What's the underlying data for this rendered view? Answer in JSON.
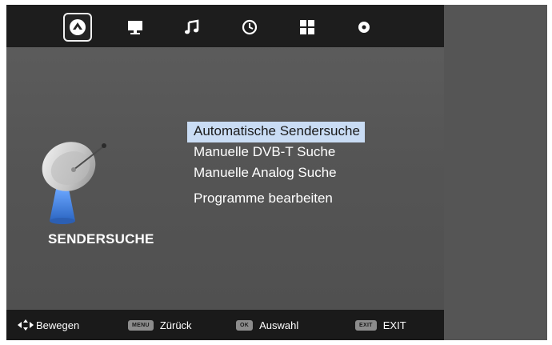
{
  "tabs": [
    {
      "icon": "satellite-dish-icon",
      "active": true
    },
    {
      "icon": "monitor-icon",
      "active": false
    },
    {
      "icon": "music-note-icon",
      "active": false
    },
    {
      "icon": "clock-icon",
      "active": false
    },
    {
      "icon": "grid-icon",
      "active": false
    },
    {
      "icon": "gear-icon",
      "active": false
    }
  ],
  "section": {
    "title": "SENDERSUCHE",
    "icon": "satellite-dish-icon"
  },
  "menu": {
    "items": [
      {
        "label": "Automatische Sendersuche",
        "selected": true
      },
      {
        "label": "Manuelle DVB-T Suche",
        "selected": false
      },
      {
        "label": "Manuelle Analog Suche",
        "selected": false
      },
      {
        "label": "Programme bearbeiten",
        "selected": false
      }
    ]
  },
  "footer": {
    "move": {
      "icon": "direction-arrows-icon",
      "label": "Bewegen"
    },
    "back": {
      "key": "MENU",
      "label": "Zürück"
    },
    "select": {
      "key": "OK",
      "label": "Auswahl"
    },
    "exit": {
      "key": "EXIT",
      "label": "EXIT"
    }
  },
  "colors": {
    "selection": "#c9dcf4",
    "bar": "#1d1d1d",
    "panel": "#555555",
    "dish_blue": "#3f7fd6"
  }
}
